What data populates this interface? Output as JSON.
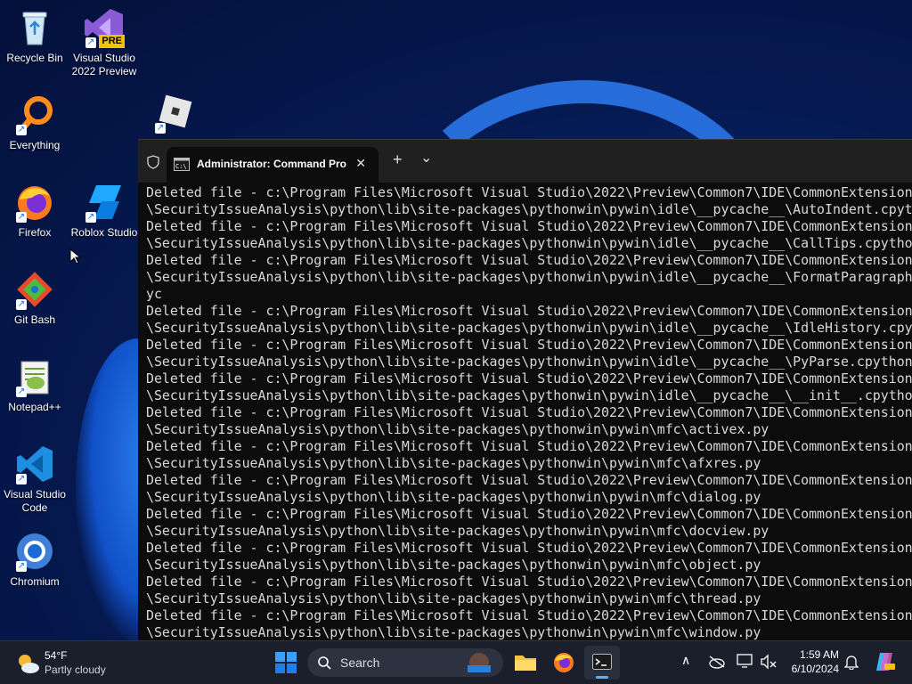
{
  "desktop": {
    "icons": [
      {
        "label": "Recycle Bin"
      },
      {
        "label": "Visual Studio 2022 Preview",
        "badge": "PRE"
      },
      {
        "label": "Everything"
      },
      {
        "label": "Firefox"
      },
      {
        "label": "Roblox Studio"
      },
      {
        "label": "Git Bash"
      },
      {
        "label": "Notepad++"
      },
      {
        "label": "Visual Studio Code"
      },
      {
        "label": "Chromium"
      }
    ]
  },
  "terminal": {
    "tab_title": "Administrator: Command Pro",
    "new_tab": "+",
    "dropdown": "⌄",
    "close": "✕",
    "lines": [
      "Deleted file - c:\\Program Files\\Microsoft Visual Studio\\2022\\Preview\\Common7\\IDE\\CommonExtensions",
      "\\SecurityIssueAnalysis\\python\\lib\\site-packages\\pythonwin\\pywin\\idle\\__pycache__\\AutoIndent.cpython",
      "Deleted file - c:\\Program Files\\Microsoft Visual Studio\\2022\\Preview\\Common7\\IDE\\CommonExtensions",
      "\\SecurityIssueAnalysis\\python\\lib\\site-packages\\pythonwin\\pywin\\idle\\__pycache__\\CallTips.cpython",
      "Deleted file - c:\\Program Files\\Microsoft Visual Studio\\2022\\Preview\\Common7\\IDE\\CommonExtensions",
      "\\SecurityIssueAnalysis\\python\\lib\\site-packages\\pythonwin\\pywin\\idle\\__pycache__\\FormatParagraph",
      "yc",
      "Deleted file - c:\\Program Files\\Microsoft Visual Studio\\2022\\Preview\\Common7\\IDE\\CommonExtensions",
      "\\SecurityIssueAnalysis\\python\\lib\\site-packages\\pythonwin\\pywin\\idle\\__pycache__\\IdleHistory.cpyt",
      "Deleted file - c:\\Program Files\\Microsoft Visual Studio\\2022\\Preview\\Common7\\IDE\\CommonExtensions",
      "\\SecurityIssueAnalysis\\python\\lib\\site-packages\\pythonwin\\pywin\\idle\\__pycache__\\PyParse.cpython",
      "Deleted file - c:\\Program Files\\Microsoft Visual Studio\\2022\\Preview\\Common7\\IDE\\CommonExtensions",
      "\\SecurityIssueAnalysis\\python\\lib\\site-packages\\pythonwin\\pywin\\idle\\__pycache__\\__init__.cpython",
      "Deleted file - c:\\Program Files\\Microsoft Visual Studio\\2022\\Preview\\Common7\\IDE\\CommonExtensions",
      "\\SecurityIssueAnalysis\\python\\lib\\site-packages\\pythonwin\\pywin\\mfc\\activex.py",
      "Deleted file - c:\\Program Files\\Microsoft Visual Studio\\2022\\Preview\\Common7\\IDE\\CommonExtensions",
      "\\SecurityIssueAnalysis\\python\\lib\\site-packages\\pythonwin\\pywin\\mfc\\afxres.py",
      "Deleted file - c:\\Program Files\\Microsoft Visual Studio\\2022\\Preview\\Common7\\IDE\\CommonExtensions",
      "\\SecurityIssueAnalysis\\python\\lib\\site-packages\\pythonwin\\pywin\\mfc\\dialog.py",
      "Deleted file - c:\\Program Files\\Microsoft Visual Studio\\2022\\Preview\\Common7\\IDE\\CommonExtensions",
      "\\SecurityIssueAnalysis\\python\\lib\\site-packages\\pythonwin\\pywin\\mfc\\docview.py",
      "Deleted file - c:\\Program Files\\Microsoft Visual Studio\\2022\\Preview\\Common7\\IDE\\CommonExtensions",
      "\\SecurityIssueAnalysis\\python\\lib\\site-packages\\pythonwin\\pywin\\mfc\\object.py",
      "Deleted file - c:\\Program Files\\Microsoft Visual Studio\\2022\\Preview\\Common7\\IDE\\CommonExtensions",
      "\\SecurityIssueAnalysis\\python\\lib\\site-packages\\pythonwin\\pywin\\mfc\\thread.py",
      "Deleted file - c:\\Program Files\\Microsoft Visual Studio\\2022\\Preview\\Common7\\IDE\\CommonExtensions",
      "\\SecurityIssueAnalysis\\python\\lib\\site-packages\\pythonwin\\pywin\\mfc\\window.py"
    ]
  },
  "taskbar": {
    "weather": {
      "temp": "54°F",
      "condition": "Partly cloudy"
    },
    "search_label": "Search",
    "time": "1:59 AM",
    "date": "6/10/2024"
  }
}
